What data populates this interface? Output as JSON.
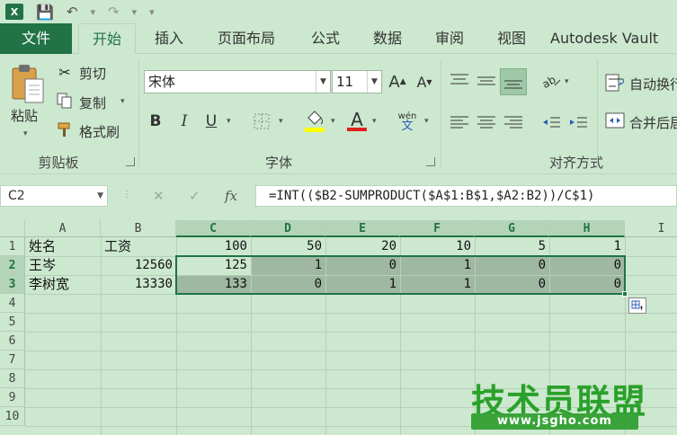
{
  "app": {
    "logo_letter": "X"
  },
  "tabs": [
    {
      "label": "文件"
    },
    {
      "label": "开始"
    },
    {
      "label": "插入"
    },
    {
      "label": "页面布局"
    },
    {
      "label": "公式"
    },
    {
      "label": "数据"
    },
    {
      "label": "审阅"
    },
    {
      "label": "视图"
    },
    {
      "label": "Autodesk Vault"
    }
  ],
  "clipboard": {
    "paste_label": "粘贴",
    "cut_label": "剪切",
    "copy_label": "复制",
    "format_painter_label": "格式刷",
    "group_label": "剪贴板"
  },
  "font": {
    "font_name": "宋体",
    "font_size": "11",
    "group_label": "字体",
    "bold": "B",
    "italic": "I",
    "underline": "U",
    "phonetic_top": "wén",
    "phonetic_bottom": "文",
    "grow": "A",
    "shrink": "A",
    "font_color_letter": "A",
    "font_color": "#e0201c",
    "fill_color": "#ffff00"
  },
  "alignment": {
    "wrap_label": "自动换行",
    "merge_label": "合并后居中",
    "group_label": "对齐方式"
  },
  "formula_bar": {
    "name_box": "C2",
    "fx": "fx",
    "formula": "=INT(($B2-SUMPRODUCT($A$1:B$1,$A2:B2))/C$1)"
  },
  "sheet": {
    "columns": [
      "A",
      "B",
      "C",
      "D",
      "E",
      "F",
      "G",
      "H",
      "I"
    ],
    "rows": [
      "1",
      "2",
      "3",
      "4",
      "5",
      "6",
      "7",
      "8",
      "9",
      "10"
    ],
    "row1": {
      "A": "姓名",
      "B": "工资",
      "C": "100",
      "D": "50",
      "E": "20",
      "F": "10",
      "G": "5",
      "H": "1"
    },
    "row2": {
      "A": "王岑",
      "B": "12560",
      "C": "125",
      "D": "1",
      "E": "0",
      "F": "1",
      "G": "0",
      "H": "0"
    },
    "row3": {
      "A": "李树宽",
      "B": "13330",
      "C": "133",
      "D": "0",
      "E": "1",
      "F": "1",
      "G": "0",
      "H": "0"
    }
  },
  "watermark": {
    "text": "技术员联盟",
    "url": "www.jsgho.com"
  }
}
